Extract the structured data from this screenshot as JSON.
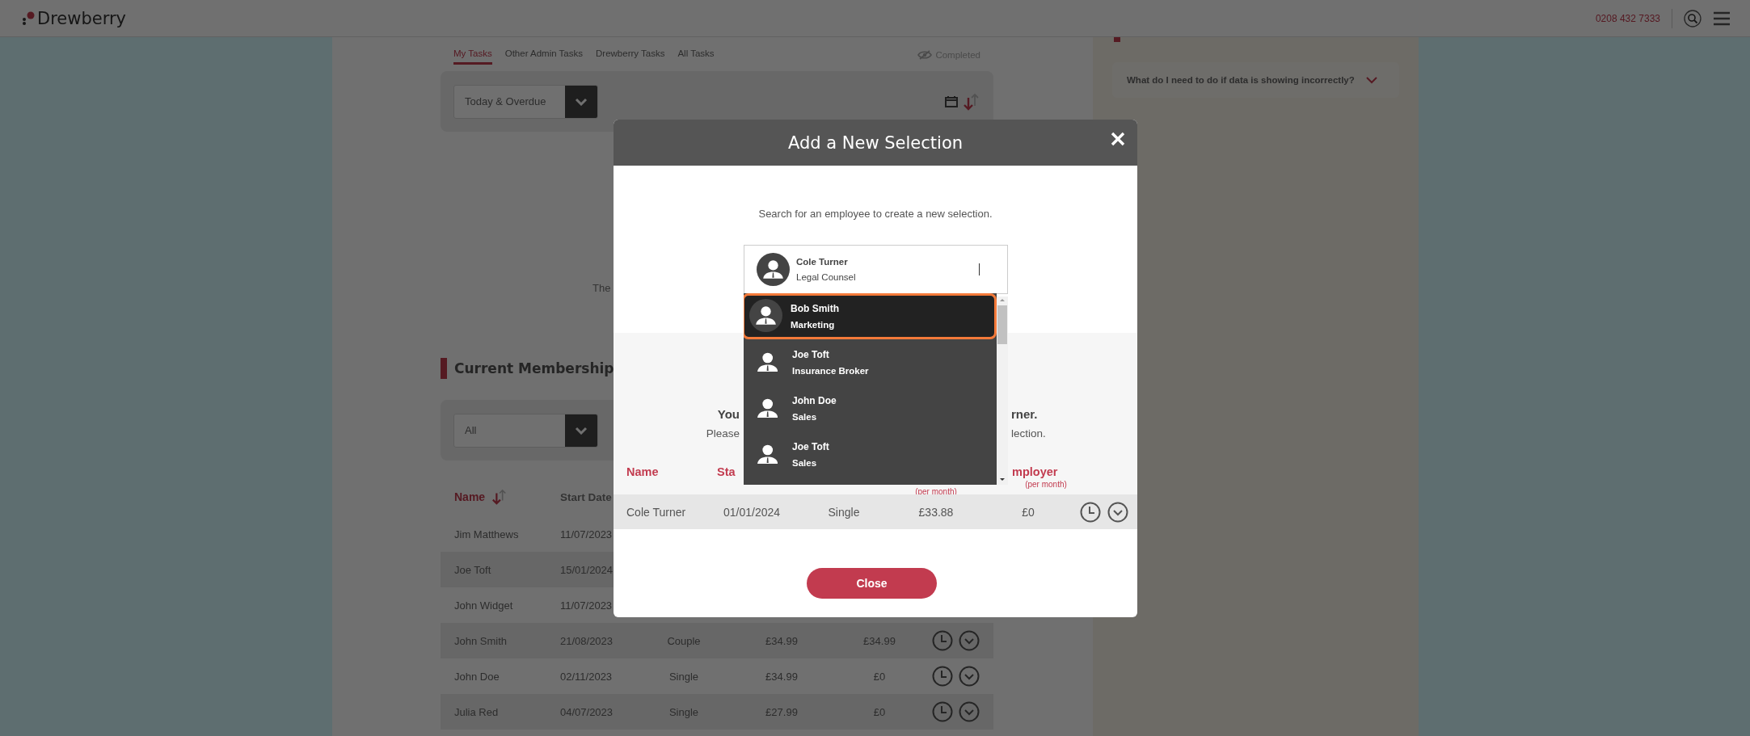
{
  "header": {
    "logo": "Drewberry",
    "phone": "0208 432 7333"
  },
  "tasks": {
    "tabs": [
      {
        "label": "My Tasks",
        "selected": true
      },
      {
        "label": "Other Admin Tasks",
        "selected": false
      },
      {
        "label": "Drewberry Tasks",
        "selected": false
      },
      {
        "label": "All Tasks",
        "selected": false
      }
    ],
    "completed_toggle": "Completed",
    "filter": "Today & Overdue",
    "message_fragment": "The"
  },
  "membership": {
    "title": "Current Membership",
    "filter": "All",
    "columns": [
      "Name",
      "Start Date"
    ],
    "rows": [
      {
        "name": "Jim Matthews",
        "start_date": "11/07/2023"
      },
      {
        "name": "Joe Toft",
        "start_date": "15/01/2024"
      },
      {
        "name": "John Widget",
        "start_date": "11/07/2023"
      },
      {
        "name": "John Smith",
        "start_date": "21/08/2023",
        "cover": "Couple",
        "employee": "£34.99",
        "employer": "£34.99"
      },
      {
        "name": "John Doe",
        "start_date": "02/11/2023",
        "cover": "Single",
        "employee": "£34.99",
        "employer": "£0"
      },
      {
        "name": "Julia Red",
        "start_date": "04/07/2023",
        "cover": "Single",
        "employee": "£27.99",
        "employer": "£0"
      }
    ]
  },
  "help": {
    "faq": [
      {
        "question": "What do I need to do if data is showing incorrectly?",
        "expanded": false
      }
    ]
  },
  "modal": {
    "title": "Add a New Selection",
    "prompt": "Search for an employee to create a new selection.",
    "search": {
      "name": "Cole Turner",
      "role": "Legal Counsel"
    },
    "results": [
      {
        "name": "Bob Smith",
        "role": "Marketing",
        "selected": true
      },
      {
        "name": "Joe Toft",
        "role": "Insurance Broker",
        "selected": false
      },
      {
        "name": "John Doe",
        "role": "Sales",
        "selected": false
      },
      {
        "name": "Joe Toft",
        "role": "Sales",
        "selected": false
      }
    ],
    "notice": [
      {
        "kind": "bold",
        "start": "You",
        "end": "rner."
      },
      {
        "kind": "plain",
        "start": "Please",
        "end": "lection."
      }
    ],
    "columns": [
      {
        "kind": "label",
        "label": "Name"
      },
      {
        "kind": "label",
        "label": "Sta"
      },
      {
        "kind": "covered"
      },
      {
        "kind": "note",
        "note": "(per month)"
      },
      {
        "kind": "label",
        "label": "mployer",
        "note": "(per month)"
      }
    ],
    "rows": [
      {
        "name": "Cole Turner",
        "start_date": "01/01/2024",
        "cover": "Single",
        "employee": "£33.88",
        "employer": "£0"
      }
    ],
    "close_button": "Close"
  }
}
